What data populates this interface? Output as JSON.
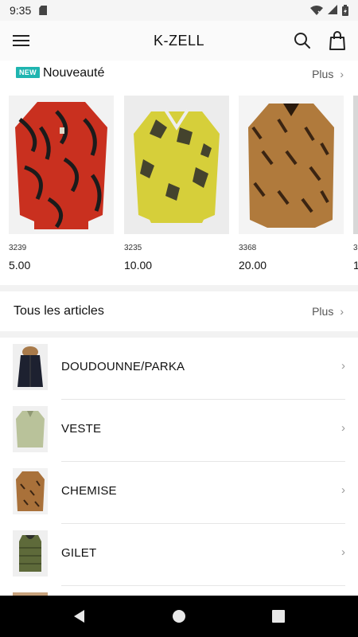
{
  "status_bar": {
    "time": "9:35"
  },
  "app_bar": {
    "title": "K-ZELL"
  },
  "new_section": {
    "badge": "NEW",
    "title": "Nouveauté",
    "more_label": "Plus",
    "products": [
      {
        "ref": "3239",
        "price": "5.00",
        "colors": [
          "#c9301f",
          "#1b1b1b"
        ]
      },
      {
        "ref": "3235",
        "price": "10.00",
        "colors": [
          "#d6cf3a",
          "#2b2b2b"
        ]
      },
      {
        "ref": "3368",
        "price": "20.00",
        "colors": [
          "#b07a3c",
          "#3a2412"
        ]
      },
      {
        "ref": "3",
        "price": "1",
        "colors": [
          "#cfcfcf",
          "#8a8a8a"
        ]
      }
    ]
  },
  "all_section": {
    "title": "Tous les articles",
    "more_label": "Plus",
    "categories": [
      {
        "label": "DOUDOUNNE/PARKA"
      },
      {
        "label": "VESTE"
      },
      {
        "label": "CHEMISE"
      },
      {
        "label": "GILET"
      }
    ]
  }
}
